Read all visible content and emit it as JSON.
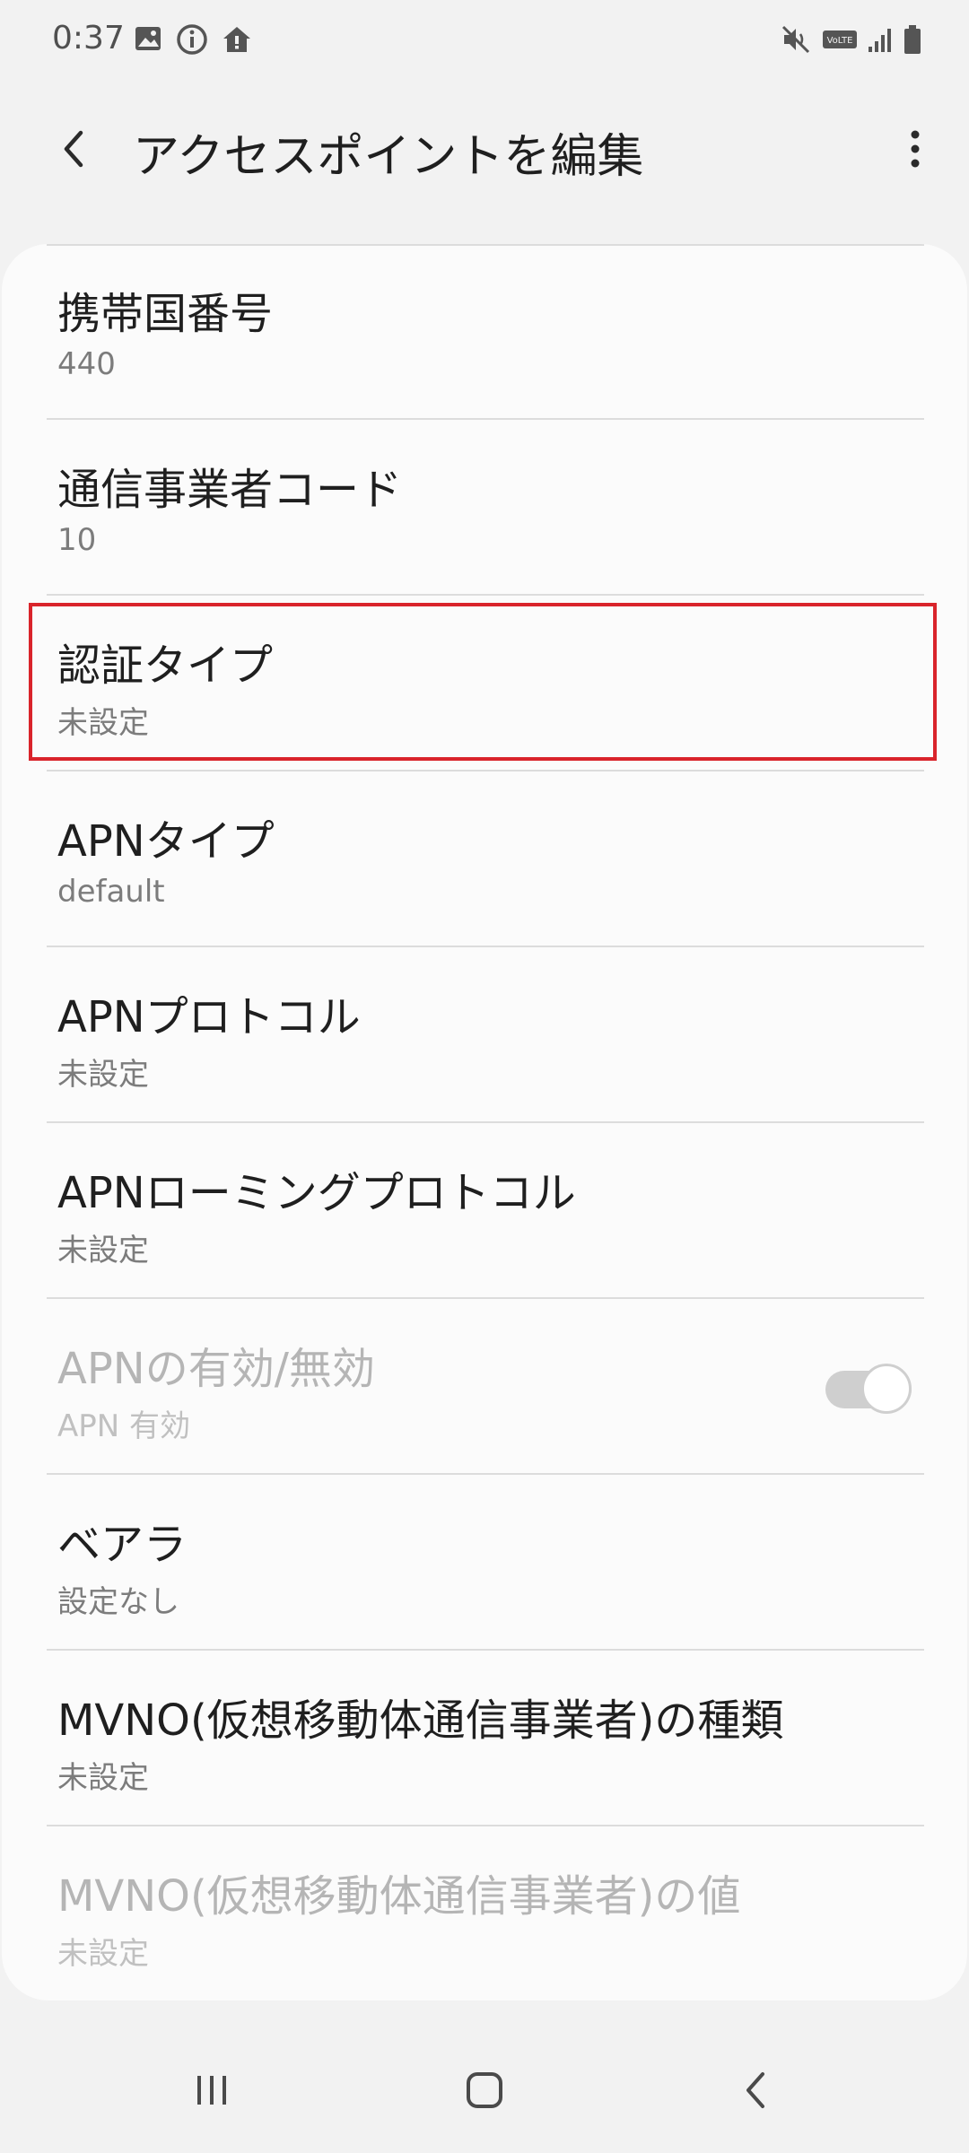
{
  "status_bar": {
    "time": "0:37",
    "left_icons": [
      "image-icon",
      "info-icon",
      "home-alert-icon"
    ],
    "right_icons": [
      "mute-vibrate-icon",
      "volte-icon",
      "signal-icon",
      "battery-icon"
    ],
    "volte_label": "VoLTE"
  },
  "app_bar": {
    "title": "アクセスポイントを編集",
    "back_icon": "back-icon",
    "more_icon": "more-vert-icon"
  },
  "settings": {
    "items": [
      {
        "title": "携帯国番号",
        "summary": "440",
        "enabled": true
      },
      {
        "title": "通信事業者コード",
        "summary": "10",
        "enabled": true
      },
      {
        "title": "認証タイプ",
        "summary": "未設定",
        "enabled": true,
        "highlighted": true
      },
      {
        "title": "APNタイプ",
        "summary": "default",
        "enabled": true
      },
      {
        "title": "APNプロトコル",
        "summary": "未設定",
        "enabled": true
      },
      {
        "title": "APNローミングプロトコル",
        "summary": "未設定",
        "enabled": true
      },
      {
        "title": "APNの有効/無効",
        "summary": "APN 有効",
        "enabled": false,
        "toggle": true,
        "toggle_on": true
      },
      {
        "title": "ベアラ",
        "summary": "設定なし",
        "enabled": true
      },
      {
        "title": "MVNO(仮想移動体通信事業者)の種類",
        "summary": "未設定",
        "enabled": true
      },
      {
        "title": "MVNO(仮想移動体通信事業者)の値",
        "summary": "未設定",
        "enabled": false
      }
    ]
  },
  "colors": {
    "highlight": "#d9242b",
    "background": "#f2f2f2",
    "card": "#fbfbfb"
  },
  "nav_bar": {
    "icons": [
      "recent-apps-icon",
      "home-icon",
      "back-nav-icon"
    ]
  }
}
